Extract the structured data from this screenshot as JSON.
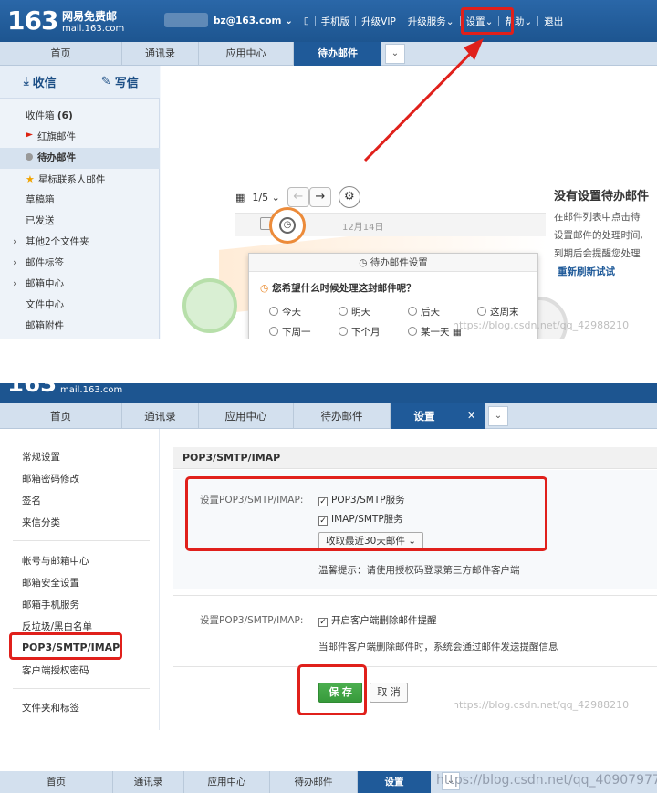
{
  "panel1": {
    "logo": {
      "number": "163",
      "cn": "网易免费邮",
      "en": "mail.163.com"
    },
    "topnav": {
      "email": "bz@163.com",
      "items": [
        "手机版",
        "升级VIP",
        "升级服务",
        "设置",
        "帮助",
        "退出"
      ]
    },
    "tabs": [
      "首页",
      "通讯录",
      "应用中心",
      "待办邮件"
    ],
    "compose": {
      "receive": "收信",
      "write": "写信"
    },
    "sidebar": {
      "inbox": "收件箱",
      "inbox_count": "(6)",
      "flagged": "红旗邮件",
      "todo": "待办邮件",
      "star": "星标联系人邮件",
      "drafts": "草稿箱",
      "sent": "已发送",
      "other": "其他2个文件夹",
      "tags": "邮件标签",
      "mailcenter": "邮箱中心",
      "filecenter": "文件中心",
      "attachments": "邮箱附件"
    },
    "toolbar": {
      "page": "1/5"
    },
    "mail_row": {
      "date": "12月14日"
    },
    "popup": {
      "title": "待办邮件设置",
      "question": "您希望什么时候处理这封邮件呢？",
      "options": [
        "今天",
        "明天",
        "后天",
        "这周末",
        "下周一",
        "下个月",
        "某一天"
      ]
    },
    "empty": {
      "title": "没有设置待办邮件",
      "lines": [
        "在邮件列表中点击待",
        "设置邮件的处理时间,",
        "到期后会提醒您处理"
      ],
      "refresh": "重新刷新试试"
    },
    "watermark": "https://blog.csdn.net/qq_42988210"
  },
  "panel2": {
    "logo_en": "mail.163.com",
    "tabs": [
      "首页",
      "通讯录",
      "应用中心",
      "待办邮件",
      "设置"
    ],
    "sidebar": {
      "group1": [
        "常规设置",
        "邮箱密码修改",
        "签名",
        "来信分类"
      ],
      "group2": [
        "帐号与邮箱中心",
        "邮箱安全设置",
        "邮箱手机服务",
        "反垃圾/黑白名单",
        "POP3/SMTP/IMAP",
        "客户端授权密码"
      ],
      "group3": [
        "文件夹和标签"
      ]
    },
    "section_title": "POP3/SMTP/IMAP",
    "group1": {
      "label": "设置POP3/SMTP/IMAP:",
      "pop3": "POP3/SMTP服务",
      "imap": "IMAP/SMTP服务",
      "select": "收取最近30天邮件",
      "tip": "温馨提示：请使用授权码登录第三方邮件客户端"
    },
    "group2": {
      "label": "设置POP3/SMTP/IMAP:",
      "option": "开启客户端删除邮件提醒",
      "tip": "当邮件客户端删除邮件时，系统会通过邮件发送提醒信息"
    },
    "save": "保 存",
    "cancel": "取 消",
    "watermark": "https://blog.csdn.net/qq_42988210"
  },
  "panel3": {
    "tabs": [
      "首页",
      "通讯录",
      "应用中心",
      "待办邮件",
      "设置"
    ],
    "watermark": "https://blog.csdn.net/qq_40907977"
  },
  "colors": {
    "brand": "#1f5a99",
    "highlight": "#e0201b",
    "save": "#4caf50",
    "accent_orange": "#ec8b3a"
  }
}
